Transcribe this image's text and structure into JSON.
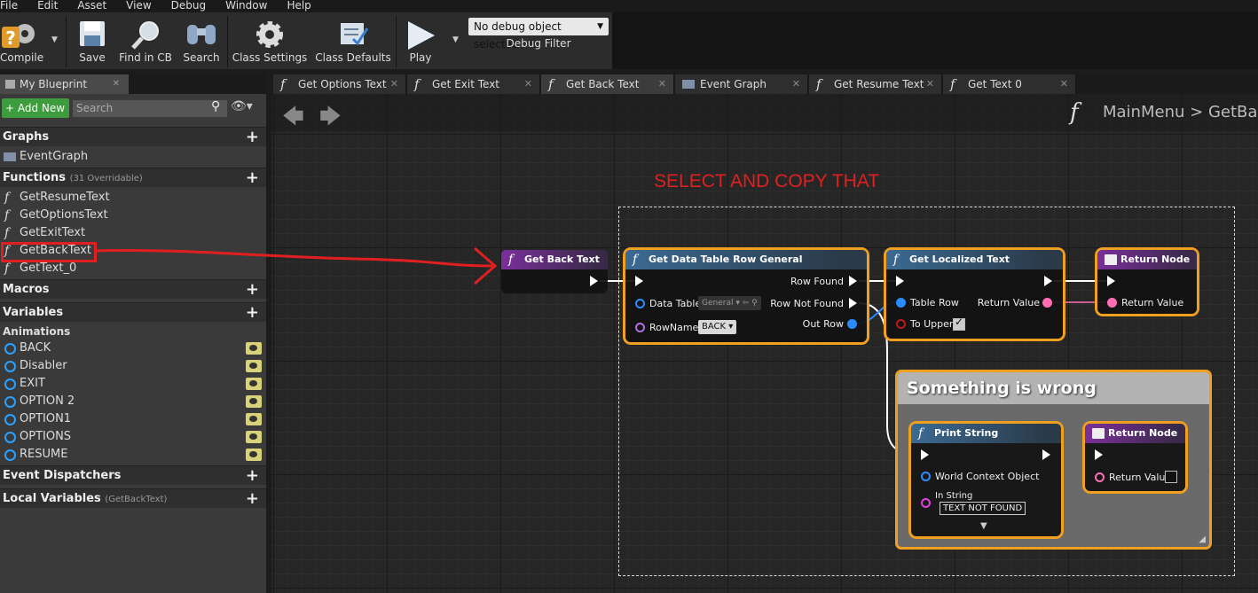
{
  "menu": [
    "File",
    "Edit",
    "Asset",
    "View",
    "Debug",
    "Window",
    "Help"
  ],
  "toolbar": {
    "compile": "Compile",
    "save": "Save",
    "find_in_cb": "Find in CB",
    "search": "Search",
    "class_settings": "Class Settings",
    "class_defaults": "Class Defaults",
    "play": "Play",
    "debug_select": "No debug object selected",
    "debug_filter": "Debug Filter"
  },
  "left_panel": {
    "tab": "My Blueprint",
    "add_new": "Add New",
    "search_placeholder": "Search",
    "graphs_header": "Graphs",
    "event_graph": "EventGraph",
    "functions_header": "Functions",
    "functions_sub": "(31 Overridable)",
    "functions": [
      "GetResumeText",
      "GetOptionsText",
      "GetExitText",
      "GetBackText",
      "GetText_0"
    ],
    "macros_header": "Macros",
    "variables_header": "Variables",
    "animations_header": "Animations",
    "variables": [
      "BACK",
      "Disabler",
      "EXIT",
      "OPTION 2",
      "OPTION1",
      "OPTIONS",
      "RESUME"
    ],
    "event_dispatchers_header": "Event Dispatchers",
    "local_variables_header": "Local Variables",
    "local_variables_sub": "(GetBackText)"
  },
  "tabs": [
    {
      "label": "Get Options Text",
      "type": "function"
    },
    {
      "label": "Get Exit Text",
      "type": "function"
    },
    {
      "label": "Get Back Text",
      "type": "function",
      "active": true
    },
    {
      "label": "Event Graph",
      "type": "graph"
    },
    {
      "label": "Get Resume Text",
      "type": "function"
    },
    {
      "label": "Get Text 0",
      "type": "function"
    }
  ],
  "breadcrumb": {
    "parent": "MainMenu",
    "sep": ">",
    "current": "GetBac"
  },
  "annotation": "SELECT AND COPY THAT",
  "nodes": {
    "entry": {
      "title": "Get Back Text"
    },
    "get_row": {
      "title": "Get Data Table Row General",
      "data_table": "Data Table",
      "data_table_value": "General",
      "row_name": "RowName",
      "row_name_value": "BACK",
      "row_found": "Row Found",
      "row_not_found": "Row Not Found",
      "out_row": "Out Row"
    },
    "localized": {
      "title": "Get Localized Text",
      "table_row": "Table Row",
      "to_upper": "To Upper",
      "return_value": "Return Value"
    },
    "return1": {
      "title": "Return Node",
      "return_value": "Return Value"
    },
    "comment": "Something is wrong",
    "print": {
      "title": "Print String",
      "world_ctx": "World Context Object",
      "in_string": "In String",
      "in_string_value": "TEXT NOT FOUND"
    },
    "return2": {
      "title": "Return Node",
      "return_value": "Return Value"
    }
  },
  "colors": {
    "accent_selected": "#f0a020",
    "annotation": "#e02020",
    "pin_blue": "#2a8cff",
    "pin_pink": "#ff6eb4",
    "pin_purple": "#b070e0",
    "pin_red": "#c01818"
  }
}
